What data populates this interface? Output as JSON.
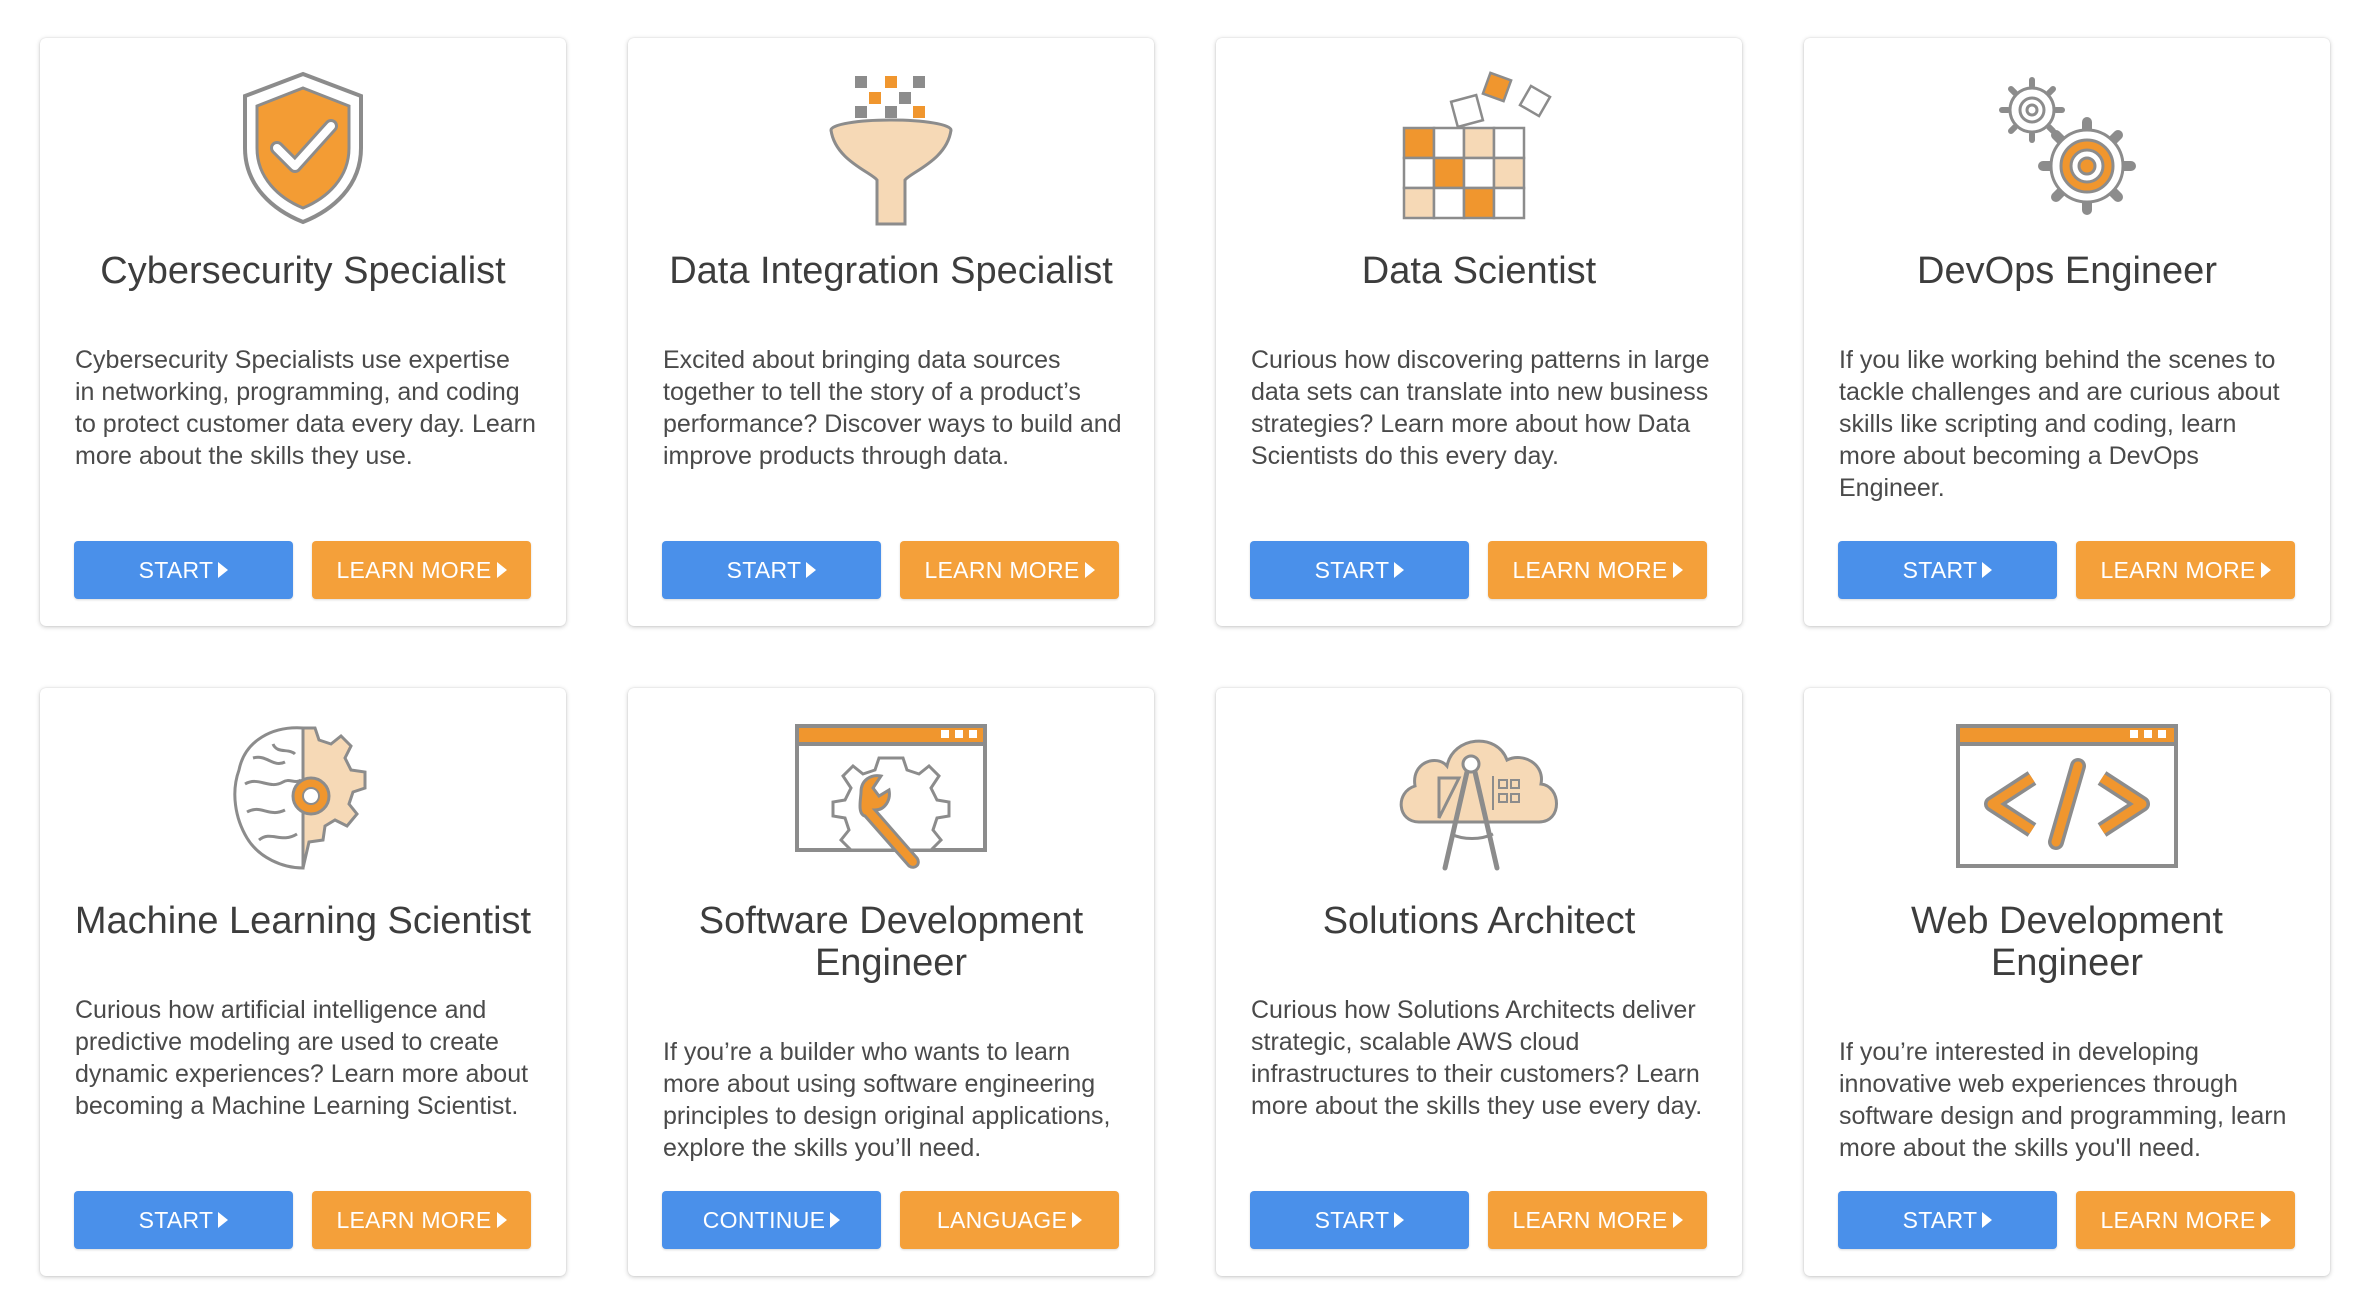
{
  "colors": {
    "primary_button": "#4a90ea",
    "secondary_button": "#f4a03a",
    "icon_accent": "#f0962e",
    "icon_stroke": "#8c8c8c"
  },
  "cards": [
    {
      "icon": "shield-check-icon",
      "title": "Cybersecurity Specialist",
      "description": "Cybersecurity Specialists use expertise in networking, programming, and coding to protect customer data every day. Learn more about the skills they use.",
      "primary_label": "START",
      "secondary_label": "LEARN MORE"
    },
    {
      "icon": "funnel-icon",
      "title": "Data Integration Specialist",
      "description": "Excited about bringing data sources together to tell the story of a product’s performance? Discover ways to build and improve products through data.",
      "primary_label": "START",
      "secondary_label": "LEARN MORE"
    },
    {
      "icon": "data-cubes-icon",
      "title": "Data Scientist",
      "description": "Curious how discovering patterns in large data sets can translate into new business strategies? Learn more about how Data Scientists do this every day.",
      "primary_label": "START",
      "secondary_label": "LEARN MORE"
    },
    {
      "icon": "gears-icon",
      "title": "DevOps Engineer",
      "description": "If you like working behind the scenes to tackle challenges and are curious about skills like scripting and coding, learn more about becoming a DevOps Engineer.",
      "primary_label": "START",
      "secondary_label": "LEARN MORE"
    },
    {
      "icon": "brain-gear-icon",
      "title": "Machine Learning Scientist",
      "description": "Curious how artificial intelligence and predictive modeling are used to create dynamic experiences? Learn more about becoming a Machine Learning Scientist.",
      "primary_label": "START",
      "secondary_label": "LEARN MORE"
    },
    {
      "icon": "browser-wrench-icon",
      "title": "Software Development Engineer",
      "description": "If you’re a builder who wants to learn more about using software engineering principles to design original applications, explore the skills you’ll need.",
      "primary_label": "CONTINUE",
      "secondary_label": "LANGUAGE"
    },
    {
      "icon": "cloud-compass-icon",
      "title": "Solutions Architect",
      "description": "Curious how Solutions Architects deliver strategic, scalable AWS cloud infrastructures to their customers? Learn more about the skills they use every day.",
      "primary_label": "START",
      "secondary_label": "LEARN MORE"
    },
    {
      "icon": "browser-code-icon",
      "title": "Web Development Engineer",
      "description": "If you’re interested in developing innovative web experiences through software design and programming, learn more about the skills you'll need.",
      "primary_label": "START",
      "secondary_label": "LEARN MORE"
    }
  ]
}
